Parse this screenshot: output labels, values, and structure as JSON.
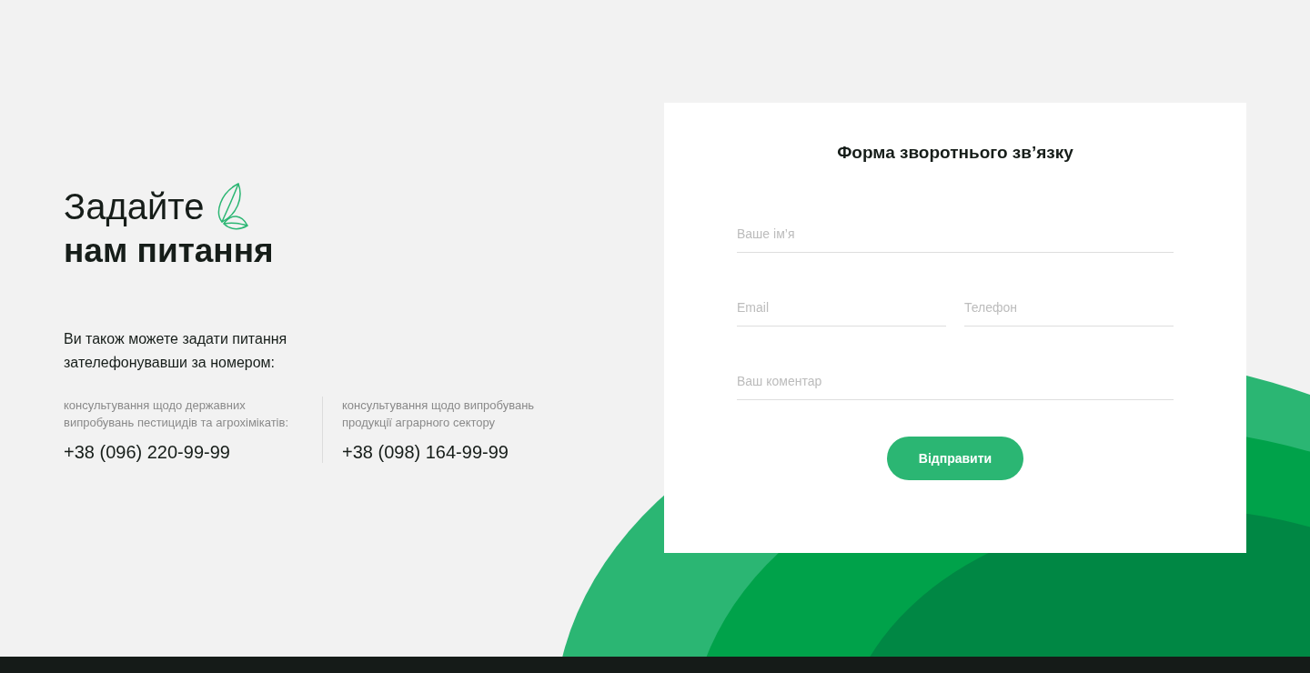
{
  "heading": {
    "light": "Задайте",
    "bold": "нам питання"
  },
  "intro": "Ви також можете задати питання зателефонувавши за номером:",
  "contacts": [
    {
      "description": "консультування щодо державних випробувань пестицидів та агрохімікатів:",
      "phone": "+38 (096) 220-99-99"
    },
    {
      "description": "консультування щодо випробувань продукції аграрного сектору",
      "phone": "+38 (098) 164-99-99"
    }
  ],
  "form": {
    "title": "Форма зворотнього зв’язку",
    "rows": [
      [
        {
          "placeholder": "Ваше ім’я"
        }
      ],
      [
        {
          "placeholder": "Email"
        },
        {
          "placeholder": "Телефон"
        }
      ],
      [
        {
          "placeholder": "Ваш коментар"
        }
      ]
    ],
    "submit": "Відправити"
  }
}
